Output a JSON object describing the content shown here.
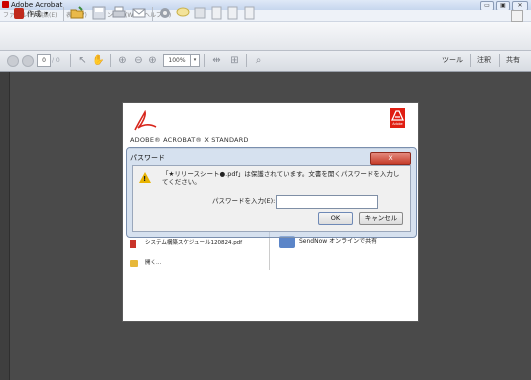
{
  "window": {
    "title": "Adobe Acrobat",
    "minimize": "▭",
    "maximize": "▣",
    "close": "✕"
  },
  "menubar": {
    "items": [
      "ファイル(F)",
      "編集(E)",
      "表示(V)",
      "ウィンドウ(W)",
      "ヘルプ(H)"
    ]
  },
  "toolbar": {
    "create_label": "作成",
    "create_caret": "▾"
  },
  "navbar": {
    "page_current": "0",
    "page_total": "/ 0",
    "zoom": "100%",
    "tools": "ツール",
    "comment": "注釈",
    "share": "共有"
  },
  "welcome": {
    "product_name": "ADOBE® ACROBAT® X STANDARD",
    "adobe_logo": "Adobe",
    "recent_file": "システム構築スケジュール120824.pdf",
    "open_label": "開く...",
    "sendnow_label": "SendNow オンラインで共有"
  },
  "dialog": {
    "title": "パスワード",
    "close": "X",
    "message": "「★リリースシート●.pdf」は保護されています。文書を開くパスワードを入力してください。",
    "password_label": "パスワードを入力(E):",
    "password_value": "",
    "ok": "OK",
    "cancel": "キャンセル"
  },
  "colors": {
    "accent": "#e01e12",
    "workspace": "#4a4a4a"
  }
}
